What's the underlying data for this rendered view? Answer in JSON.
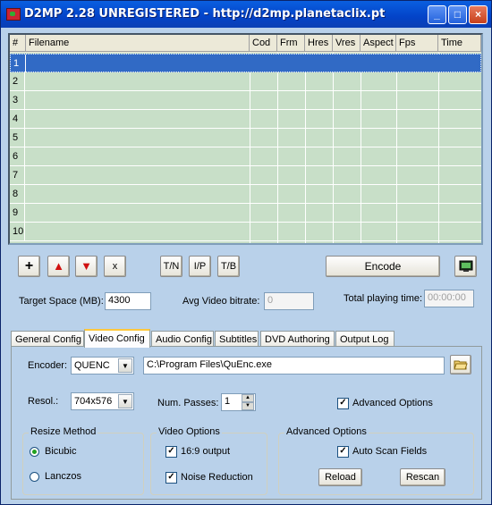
{
  "title": "D2MP 2.28 UNREGISTERED - http://d2mp.planetaclix.pt",
  "window_buttons": {
    "minimize": "_",
    "maximize": "□",
    "close": "×"
  },
  "grid": {
    "columns": [
      "#",
      "Filename",
      "Cod",
      "Frm",
      "Hres",
      "Vres",
      "Aspect",
      "Fps",
      "Time"
    ],
    "rows": [
      "1",
      "2",
      "3",
      "4",
      "5",
      "6",
      "7",
      "8",
      "9",
      "10"
    ],
    "selected_row": "1"
  },
  "toolbar": {
    "add": "+",
    "up": "▲",
    "down": "▼",
    "remove": "x",
    "tn": "T/N",
    "ip": "I/P",
    "tb": "T/B",
    "encode": "Encode"
  },
  "target_space_label": "Target Space (MB):",
  "target_space_value": "4300",
  "avg_bitrate_label": "Avg Video bitrate:",
  "avg_bitrate_value": "0",
  "total_time_label": "Total playing time:",
  "total_time_value": "00:00:00",
  "tabs": [
    "General Config",
    "Video Config",
    "Audio Config",
    "Subtitles",
    "DVD Authoring",
    "Output Log"
  ],
  "active_tab": "Video Config",
  "video": {
    "encoder_label": "Encoder:",
    "encoder_value": "QUENC",
    "encoder_path": "C:\\Program Files\\QuEnc.exe",
    "resol_label": "Resol.:",
    "resol_value": "704x576",
    "passes_label": "Num. Passes:",
    "passes_value": "1",
    "advanced_options_label": "Advanced Options",
    "advanced_options_checked": true,
    "resize": {
      "label": "Resize Method",
      "bicubic": "Bicubic",
      "lanczos": "Lanczos",
      "selected": "Bicubic"
    },
    "video_options": {
      "label": "Video Options",
      "aspect169": "16:9 output",
      "aspect169_checked": true,
      "noise": "Noise Reduction",
      "noise_checked": true
    },
    "advanced": {
      "label": "Advanced Options",
      "autoscan": "Auto Scan Fields",
      "autoscan_checked": true,
      "reload": "Reload",
      "rescan": "Rescan"
    }
  }
}
